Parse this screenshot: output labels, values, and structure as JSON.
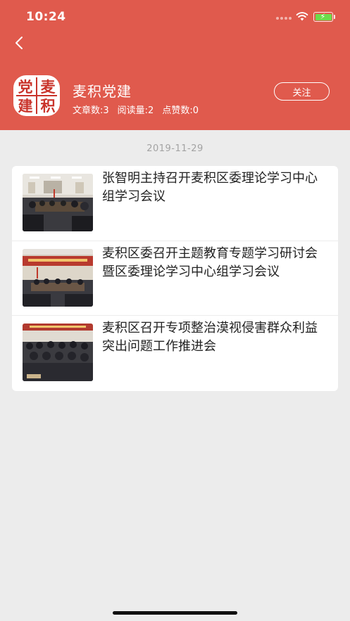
{
  "status_bar": {
    "time": "10:24"
  },
  "header": {
    "channel_name": "麦积党建",
    "logo_chars": [
      "党",
      "麦",
      "建",
      "积"
    ],
    "stats": {
      "articles": "文章数:3",
      "reads": "阅读量:2",
      "likes": "点赞数:0"
    },
    "follow_label": "关注"
  },
  "feed": {
    "date": "2019-11-29",
    "articles": [
      {
        "title": "张智明主持召开麦积区委理论学习中心组学习会议"
      },
      {
        "title": "麦积区委召开主题教育专题学习研讨会暨区委理论学习中心组学习会议"
      },
      {
        "title": "麦积区召开专项整治漠视侵害群众利益突出问题工作推进会"
      }
    ]
  },
  "colors": {
    "header_bg": "#e05a4d",
    "page_bg": "#ececec",
    "battery_fill": "#6cdc4a"
  },
  "icons": {
    "back": "chevron-left-icon",
    "wifi": "wifi-icon",
    "battery": "battery-charging-icon",
    "signal": "cellular-signal-icon"
  }
}
